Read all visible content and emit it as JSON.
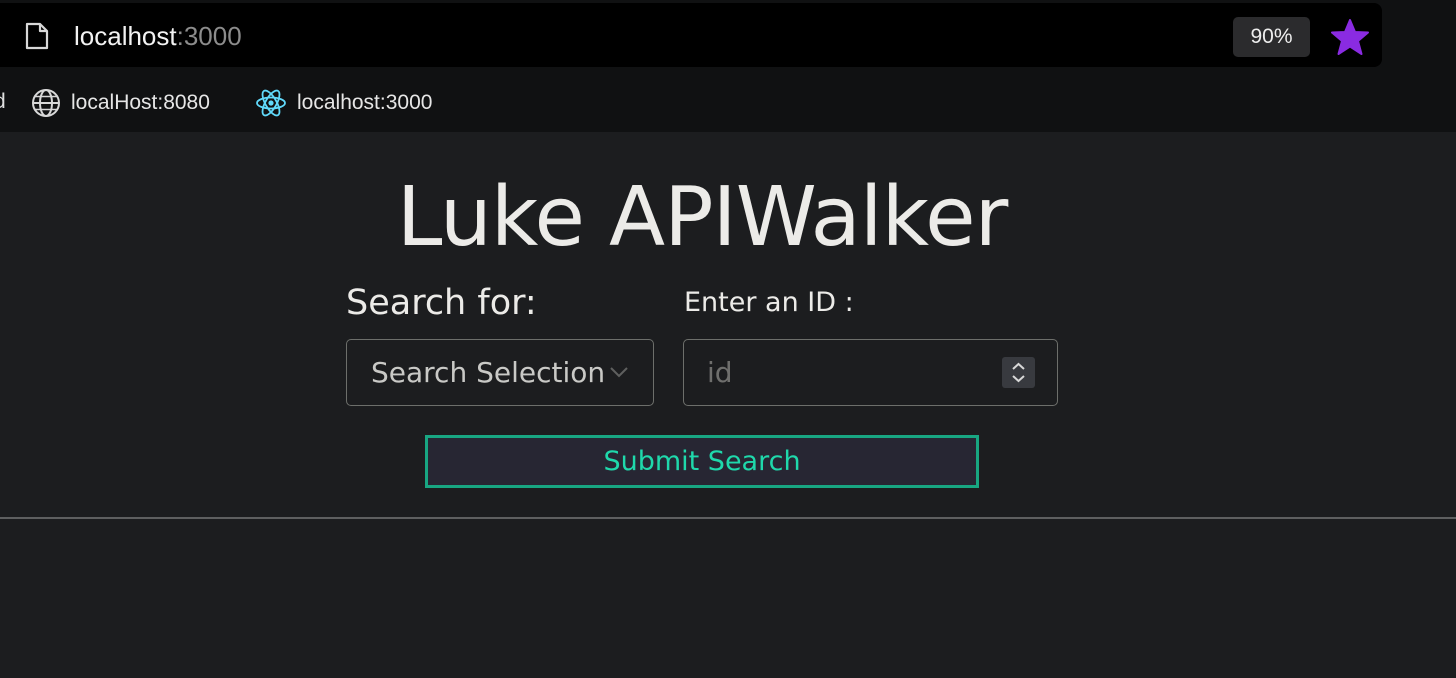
{
  "browser": {
    "url_host": "localhost",
    "url_port": ":3000",
    "zoom": "90%",
    "bookmarks_cut_text": "d",
    "bookmarks": [
      {
        "label": "localHost:8080",
        "icon": "globe-icon"
      },
      {
        "label": "localhost:3000",
        "icon": "react-icon"
      }
    ],
    "star_color": "#8a2be2"
  },
  "page": {
    "title": "Luke APIWalker",
    "search_label": "Search for:",
    "select_value": "Search Selection",
    "id_label": "Enter an ID :",
    "id_placeholder": "id",
    "submit_label": "Submit Search"
  },
  "colors": {
    "background": "#1c1d1f",
    "accent": "#1fd8ab",
    "button_border": "#18a682",
    "button_bg": "#272633"
  }
}
